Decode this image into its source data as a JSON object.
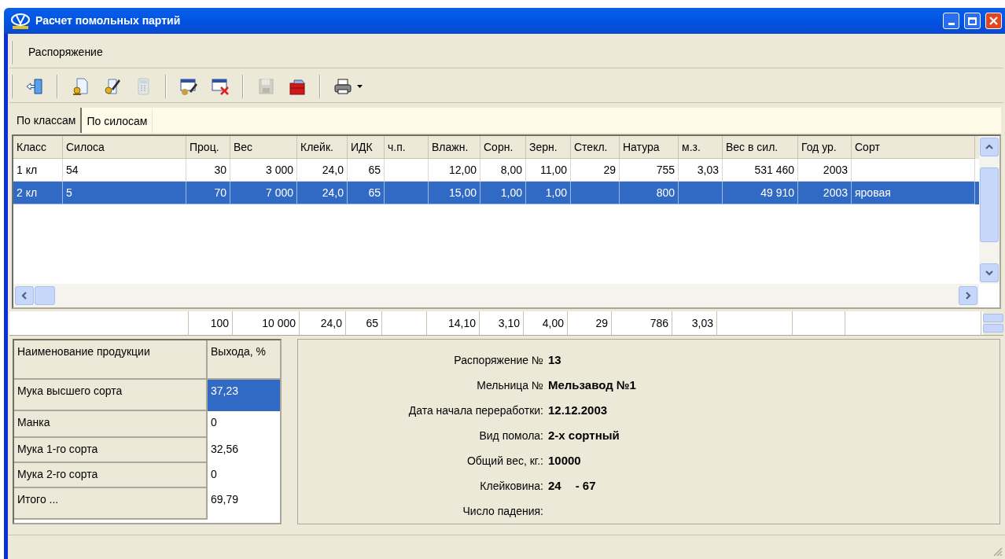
{
  "window": {
    "title": "Расчет помольных партий"
  },
  "menu": [
    {
      "label": "Распоряжение"
    }
  ],
  "toolbar": [
    {
      "kind": "exit",
      "disabled": false
    },
    {
      "kind": "separator"
    },
    {
      "kind": "new-doc",
      "disabled": false
    },
    {
      "kind": "edit-doc",
      "disabled": false
    },
    {
      "kind": "calculator",
      "disabled": true
    },
    {
      "kind": "separator"
    },
    {
      "kind": "edit-table",
      "disabled": false
    },
    {
      "kind": "delete-table",
      "disabled": false
    },
    {
      "kind": "separator"
    },
    {
      "kind": "save",
      "disabled": true
    },
    {
      "kind": "briefcase",
      "disabled": false
    },
    {
      "kind": "separator"
    },
    {
      "kind": "print",
      "disabled": false
    }
  ],
  "tabs": [
    {
      "label": "По классам",
      "selected": true
    },
    {
      "label": "По силосам",
      "selected": false
    }
  ],
  "table": {
    "columns": [
      {
        "label": "Класс",
        "kind": "text"
      },
      {
        "label": "Силоса",
        "kind": "text"
      },
      {
        "label": "Проц.",
        "kind": "number"
      },
      {
        "label": "Вес",
        "kind": "number"
      },
      {
        "label": "Клейк.",
        "kind": "number"
      },
      {
        "label": "ИДК",
        "kind": "number"
      },
      {
        "label": "ч.п.",
        "kind": "number"
      },
      {
        "label": "Влажн.",
        "kind": "number"
      },
      {
        "label": "Сорн.",
        "kind": "number"
      },
      {
        "label": "Зерн.",
        "kind": "number"
      },
      {
        "label": "Стекл.",
        "kind": "number"
      },
      {
        "label": "Натура",
        "kind": "number"
      },
      {
        "label": "м.з.",
        "kind": "number"
      },
      {
        "label": "Вес в сил.",
        "kind": "number"
      },
      {
        "label": "Год ур.",
        "kind": "number"
      },
      {
        "label": "Сорт",
        "kind": "text"
      }
    ],
    "rows": [
      {
        "selected": false,
        "cells": [
          {
            "kind": "value",
            "text": "1 кл"
          },
          {
            "kind": "value",
            "text": "54"
          },
          {
            "kind": "value",
            "text": "30"
          },
          {
            "kind": "value",
            "text": "3 000"
          },
          {
            "kind": "value",
            "text": "24,0"
          },
          {
            "kind": "value",
            "text": "65"
          },
          {
            "kind": "empty"
          },
          {
            "kind": "value",
            "text": "12,00"
          },
          {
            "kind": "value",
            "text": "8,00"
          },
          {
            "kind": "value",
            "text": "11,00"
          },
          {
            "kind": "value",
            "text": "29"
          },
          {
            "kind": "value",
            "text": "755"
          },
          {
            "kind": "value",
            "text": "3,03"
          },
          {
            "kind": "value",
            "text": "531 460"
          },
          {
            "kind": "value",
            "text": "2003"
          },
          {
            "kind": "empty"
          }
        ]
      },
      {
        "selected": true,
        "cells": [
          {
            "kind": "value",
            "text": "2 кл"
          },
          {
            "kind": "value",
            "text": "5"
          },
          {
            "kind": "value",
            "text": "70"
          },
          {
            "kind": "value",
            "text": "7 000"
          },
          {
            "kind": "value",
            "text": "24,0"
          },
          {
            "kind": "value",
            "text": "65"
          },
          {
            "kind": "empty"
          },
          {
            "kind": "value",
            "text": "15,00"
          },
          {
            "kind": "value",
            "text": "1,00"
          },
          {
            "kind": "value",
            "text": "1,00"
          },
          {
            "kind": "empty"
          },
          {
            "kind": "value",
            "text": "800"
          },
          {
            "kind": "empty"
          },
          {
            "kind": "value",
            "text": "49 910"
          },
          {
            "kind": "value",
            "text": "2003"
          },
          {
            "kind": "value",
            "text": "яровая"
          }
        ]
      }
    ],
    "totals": [
      {
        "kind": "empty"
      },
      {
        "kind": "value",
        "text": "100"
      },
      {
        "kind": "value",
        "text": "10 000"
      },
      {
        "kind": "value",
        "text": "24,0"
      },
      {
        "kind": "value",
        "text": "65"
      },
      {
        "kind": "empty"
      },
      {
        "kind": "value",
        "text": "14,10"
      },
      {
        "kind": "value",
        "text": "3,10"
      },
      {
        "kind": "value",
        "text": "4,00"
      },
      {
        "kind": "value",
        "text": "29"
      },
      {
        "kind": "value",
        "text": "786"
      },
      {
        "kind": "value",
        "text": "3,03"
      },
      {
        "kind": "empty"
      },
      {
        "kind": "empty"
      },
      {
        "kind": "empty"
      }
    ]
  },
  "products": {
    "columns": [
      "Наименование продукции",
      "Выхода, %"
    ],
    "rows": [
      {
        "name": "Мука высшего сорта",
        "value": "37,23",
        "selected": true
      },
      {
        "name": "Манка",
        "value": "0",
        "selected": false
      },
      {
        "name": "Мука 1-го сорта",
        "value": "32,56",
        "selected": false
      },
      {
        "name": "Мука 2-го сорта",
        "value": "0",
        "selected": false
      },
      {
        "name": "Итого ...",
        "value": "69,79",
        "selected": false
      }
    ]
  },
  "info": [
    {
      "label": "Распоряжение №",
      "values": [
        "13"
      ]
    },
    {
      "label": "Мельница №",
      "values": [
        "Мельзавод №1"
      ]
    },
    {
      "label": "Дата начала переработки:",
      "values": [
        "12.12.2003"
      ]
    },
    {
      "label": "Вид помола:",
      "values": [
        "2-х сортный"
      ]
    },
    {
      "label": "Общий вес, кг.:",
      "values": [
        "10000"
      ]
    },
    {
      "label": "Клейковина:",
      "values": [
        "24",
        "- 67"
      ]
    },
    {
      "label": "Число падения:"
    }
  ]
}
